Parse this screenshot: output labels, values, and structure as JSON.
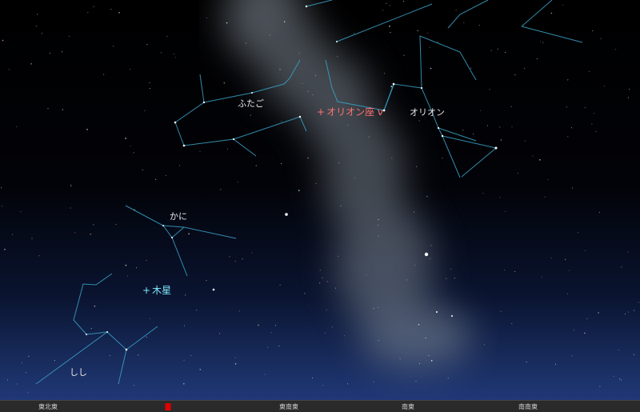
{
  "constellations": {
    "gemini": "ふたご",
    "orion": "オリオン",
    "cancer": "かに",
    "leo": "しし"
  },
  "objects": {
    "orion_nu": "オリオン座 ν",
    "jupiter": "木星"
  },
  "marks": {
    "orion_nu_mark": "+",
    "jupiter_mark": "+"
  },
  "compass": {
    "ene": "東北東",
    "east": "東",
    "ese": "東南東",
    "se": "南東",
    "sse": "南南東"
  },
  "colors": {
    "constellation_line": "#3aa3c8",
    "highlight_object": "#ff7373",
    "planet": "#7fe8ff",
    "current_direction": "#e00000"
  }
}
